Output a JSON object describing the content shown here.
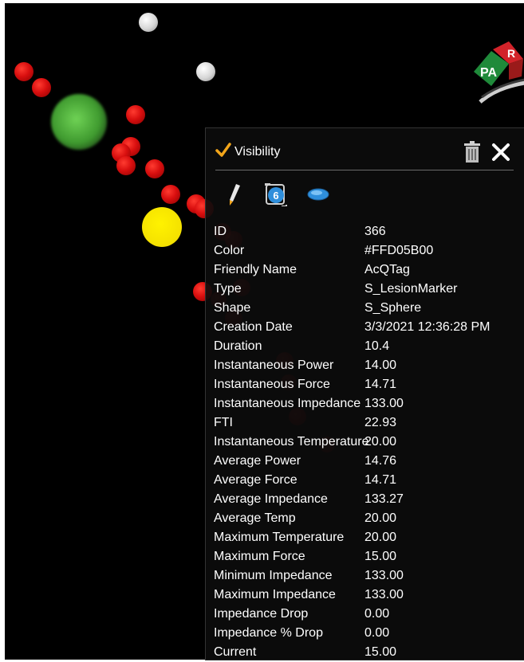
{
  "panel": {
    "visibility_label": "Visibility",
    "visibility_checked": true,
    "icons": {
      "check": "checkmark-icon",
      "trash": "trash-icon",
      "close": "close-icon",
      "edit": "pencil-icon",
      "count_badge": "point-count-icon",
      "shape": "ellipse-shape-icon"
    },
    "count_badge_value": "6",
    "properties": [
      {
        "name": "ID",
        "value": "366"
      },
      {
        "name": "Color",
        "value": "#FFD05B00"
      },
      {
        "name": "Friendly Name",
        "value": "AcQTag"
      },
      {
        "name": "Type",
        "value": "S_LesionMarker"
      },
      {
        "name": "Shape",
        "value": "S_Sphere"
      },
      {
        "name": "Creation Date",
        "value": "3/3/2021 12:36:28 PM"
      },
      {
        "name": "Duration",
        "value": "10.4"
      },
      {
        "name": "Instantaneous Power",
        "value": "14.00"
      },
      {
        "name": "Instantaneous Force",
        "value": "14.71"
      },
      {
        "name": "Instantaneous Impedance",
        "value": "133.00"
      },
      {
        "name": "FTI",
        "value": "22.93"
      },
      {
        "name": "Instantaneous Temperature",
        "value": "20.00"
      },
      {
        "name": "Average Power",
        "value": "14.76"
      },
      {
        "name": "Average Force",
        "value": "14.71"
      },
      {
        "name": "Average Impedance",
        "value": "133.27"
      },
      {
        "name": "Average Temp",
        "value": "20.00"
      },
      {
        "name": "Maximum Temperature",
        "value": "20.00"
      },
      {
        "name": "Maximum Force",
        "value": "15.00"
      },
      {
        "name": "Minimum Impedance",
        "value": "133.00"
      },
      {
        "name": "Maximum Impedance",
        "value": "133.00"
      },
      {
        "name": "Impedance Drop",
        "value": "0.00"
      },
      {
        "name": "Impedance % Drop",
        "value": "0.00"
      },
      {
        "name": "Current",
        "value": "15.00"
      }
    ]
  },
  "logo": {
    "letters_left": "PA",
    "letters_right": "R"
  },
  "colors": {
    "accent_check": "#f2a51a",
    "badge_blue": "#2f8fdc",
    "lesion_red": "#d90f0f",
    "selected_yellow": "#f4e100"
  }
}
